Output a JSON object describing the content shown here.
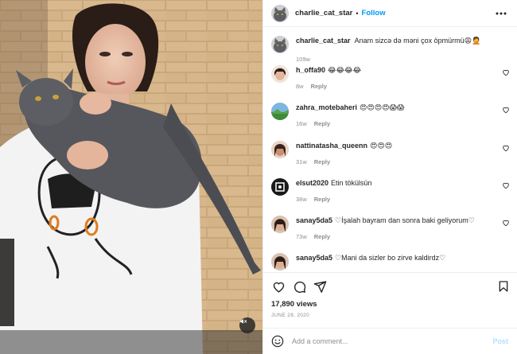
{
  "post": {
    "username": "charlie_cat_star",
    "follow_label": "Follow",
    "separator": "•",
    "more_icon": "more-horizontal-icon"
  },
  "caption": {
    "username": "charlie_cat_star",
    "text": "Anam sizcə də məni çox öpmürmü😩🤦",
    "age": "109w"
  },
  "comments": [
    {
      "username": "h_offa90",
      "text": "😂😂😂😂",
      "age": "8w",
      "reply_label": "Reply"
    },
    {
      "username": "zahra_motebaheri",
      "text": "😍😍😍😍😱😱",
      "age": "16w",
      "reply_label": "Reply"
    },
    {
      "username": "nattinatasha_queenn",
      "text": "😍😍😍",
      "age": "31w",
      "reply_label": "Reply"
    },
    {
      "username": "elsut2020",
      "text": "Etin tökülsün",
      "age": "38w",
      "reply_label": "Reply"
    },
    {
      "username": "sanay5da5",
      "text": "♡İşalah bayram dan sonra baki geliyorum♡",
      "age": "73w",
      "reply_label": "Reply"
    },
    {
      "username": "sanay5da5",
      "text": "♡Mani da sizler bo zirve kaldirdz♡",
      "age": "",
      "reply_label": ""
    }
  ],
  "actions": {
    "like_icon": "heart-icon",
    "comment_icon": "comment-icon",
    "share_icon": "paper-plane-icon",
    "save_icon": "bookmark-icon"
  },
  "stats": {
    "views": "17,890 views",
    "date": "JUNE 28, 2020"
  },
  "add_comment": {
    "placeholder": "Add a comment...",
    "post_label": "Post"
  },
  "colors": {
    "link_blue": "#0095f6",
    "post_disabled": "#b2dffc",
    "meta_gray": "#8e8e8e",
    "text": "#262626"
  },
  "media": {
    "mute_icon": "speaker-muted-icon"
  }
}
